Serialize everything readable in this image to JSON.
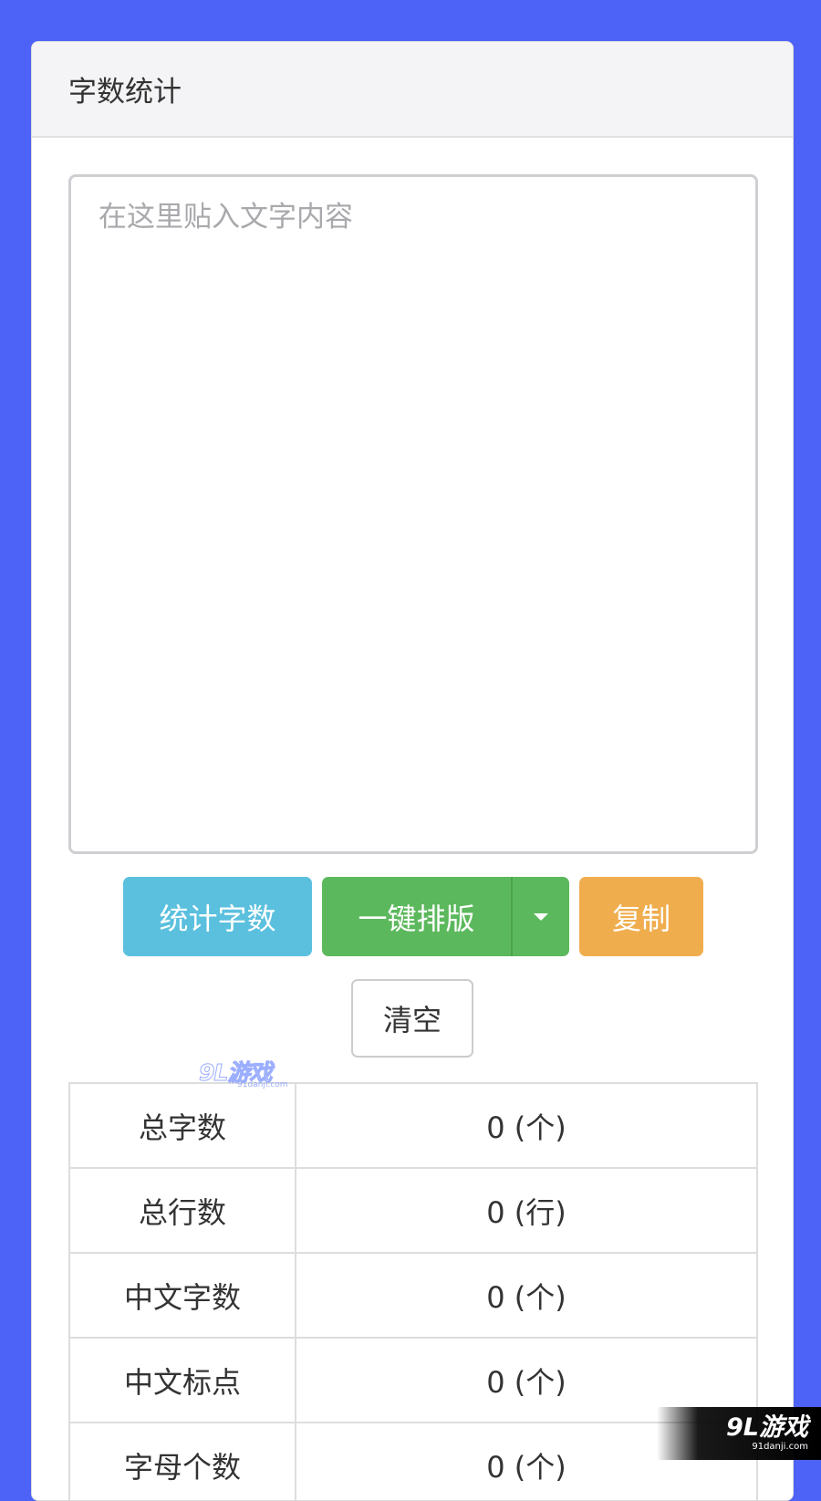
{
  "panel": {
    "title": "字数统计"
  },
  "editor": {
    "placeholder": "在这里贴入文字内容",
    "value": ""
  },
  "buttons": {
    "count_label": "统计字数",
    "format_label": "一键排版",
    "copy_label": "复制",
    "clear_label": "清空"
  },
  "stats": [
    {
      "label": "总字数",
      "value": "0 (个)"
    },
    {
      "label": "总行数",
      "value": "0 (行)"
    },
    {
      "label": "中文字数",
      "value": "0 (个)"
    },
    {
      "label": "中文标点",
      "value": "0 (个)"
    },
    {
      "label": "字母个数",
      "value": "0 (个)"
    }
  ],
  "watermark": {
    "brand": "9L游戏",
    "site": "91danji.com"
  },
  "colors": {
    "background": "#4d63f7",
    "info": "#5bc0de",
    "success": "#5cb85c",
    "warning": "#f0ad4e"
  }
}
